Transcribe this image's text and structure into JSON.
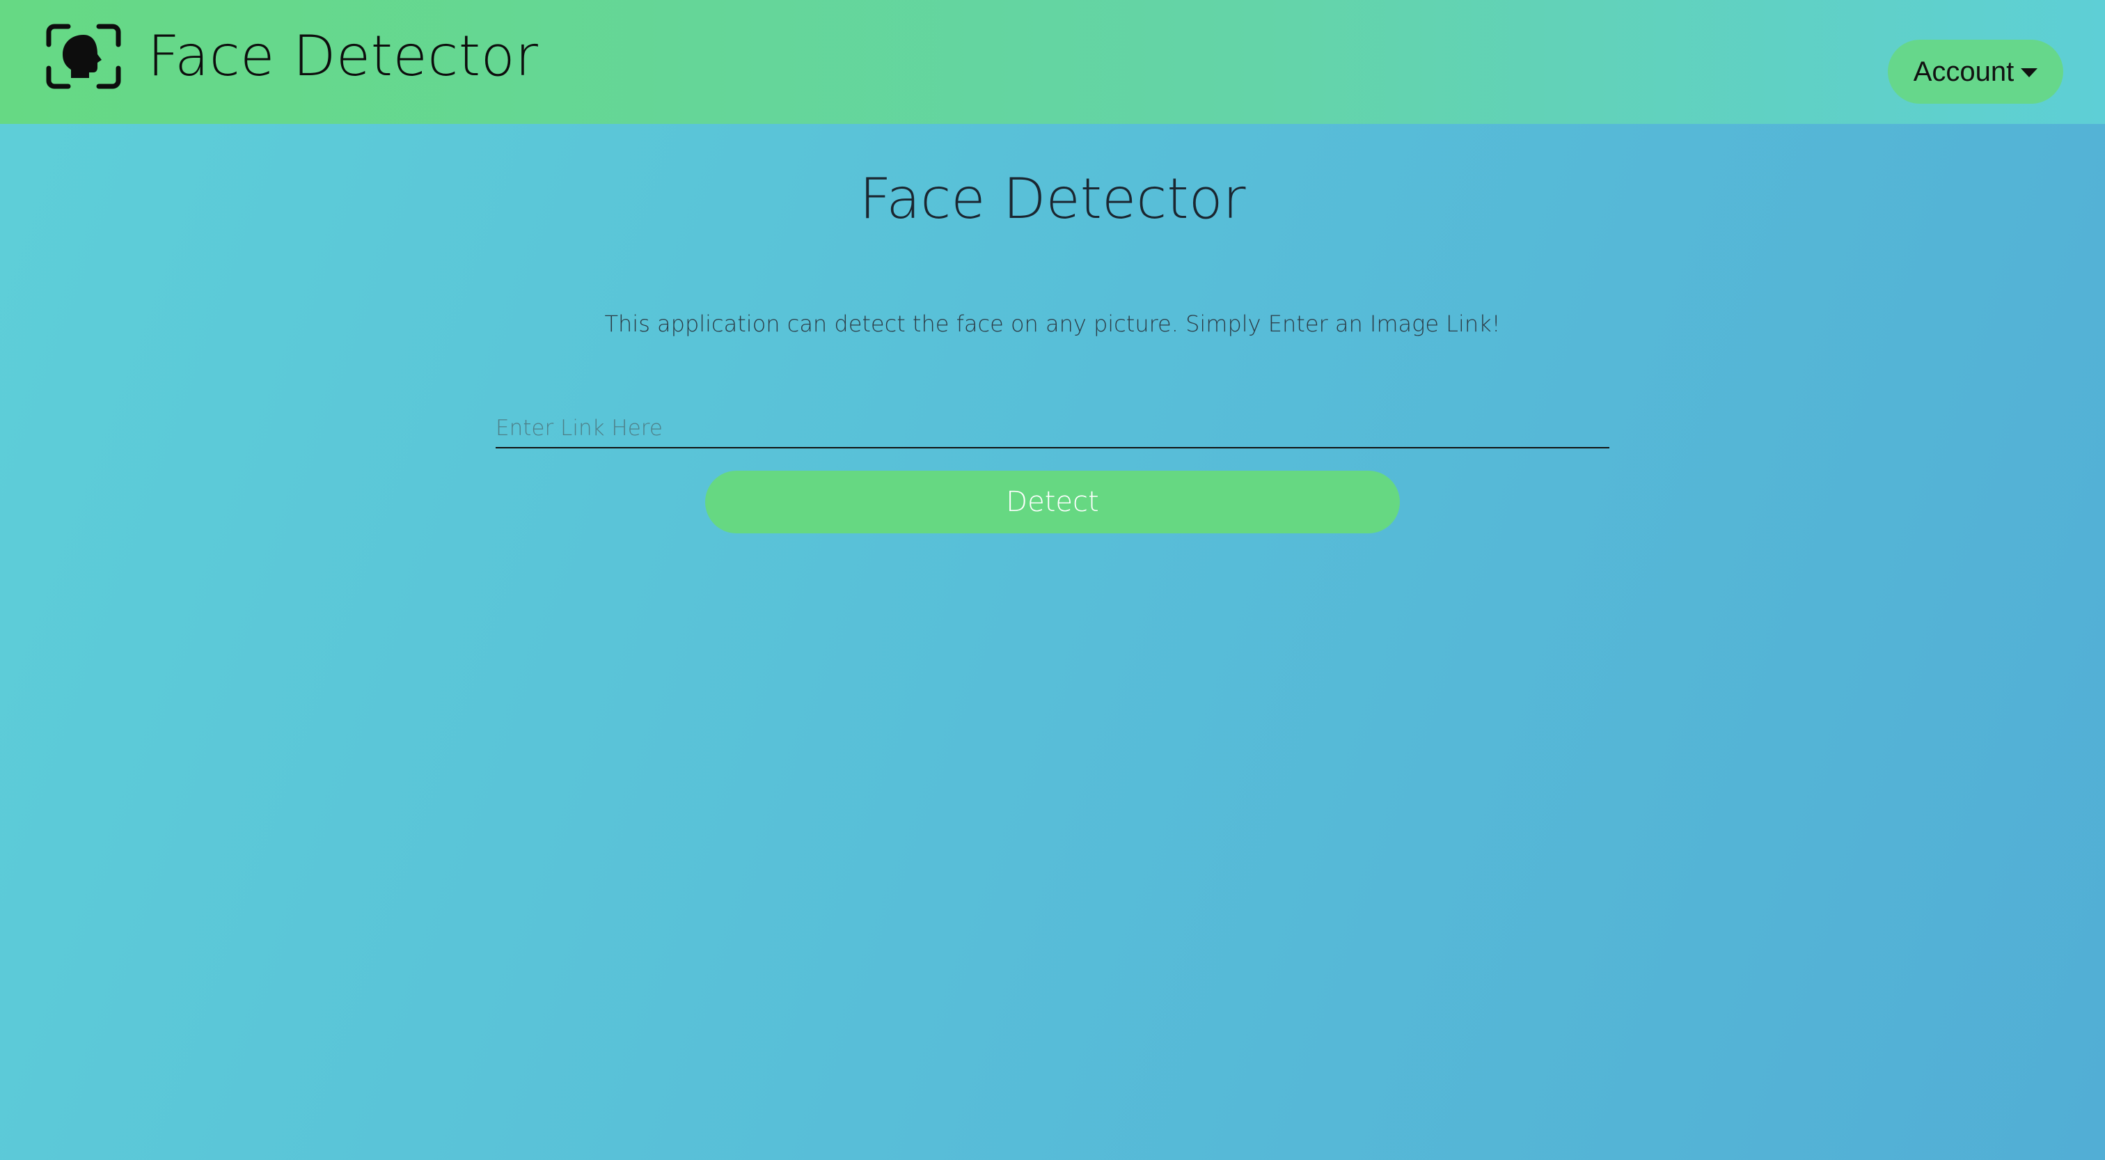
{
  "navbar": {
    "brand_icon": "face-scan-icon",
    "brand_title": "Face Detector",
    "account_label": "Account",
    "account_icon": "caret-down-icon"
  },
  "main": {
    "title": "Face Detector",
    "description": "This application can detect the face on any picture. Simply Enter an Image Link!",
    "link_input": {
      "placeholder": "Enter Link Here",
      "value": ""
    },
    "detect_label": "Detect"
  },
  "colors": {
    "navbar_start": "#66d984",
    "navbar_end": "#5ecfd6",
    "background_start": "#5ecfd8",
    "background_end": "#52aed5",
    "button": "#66d882"
  }
}
